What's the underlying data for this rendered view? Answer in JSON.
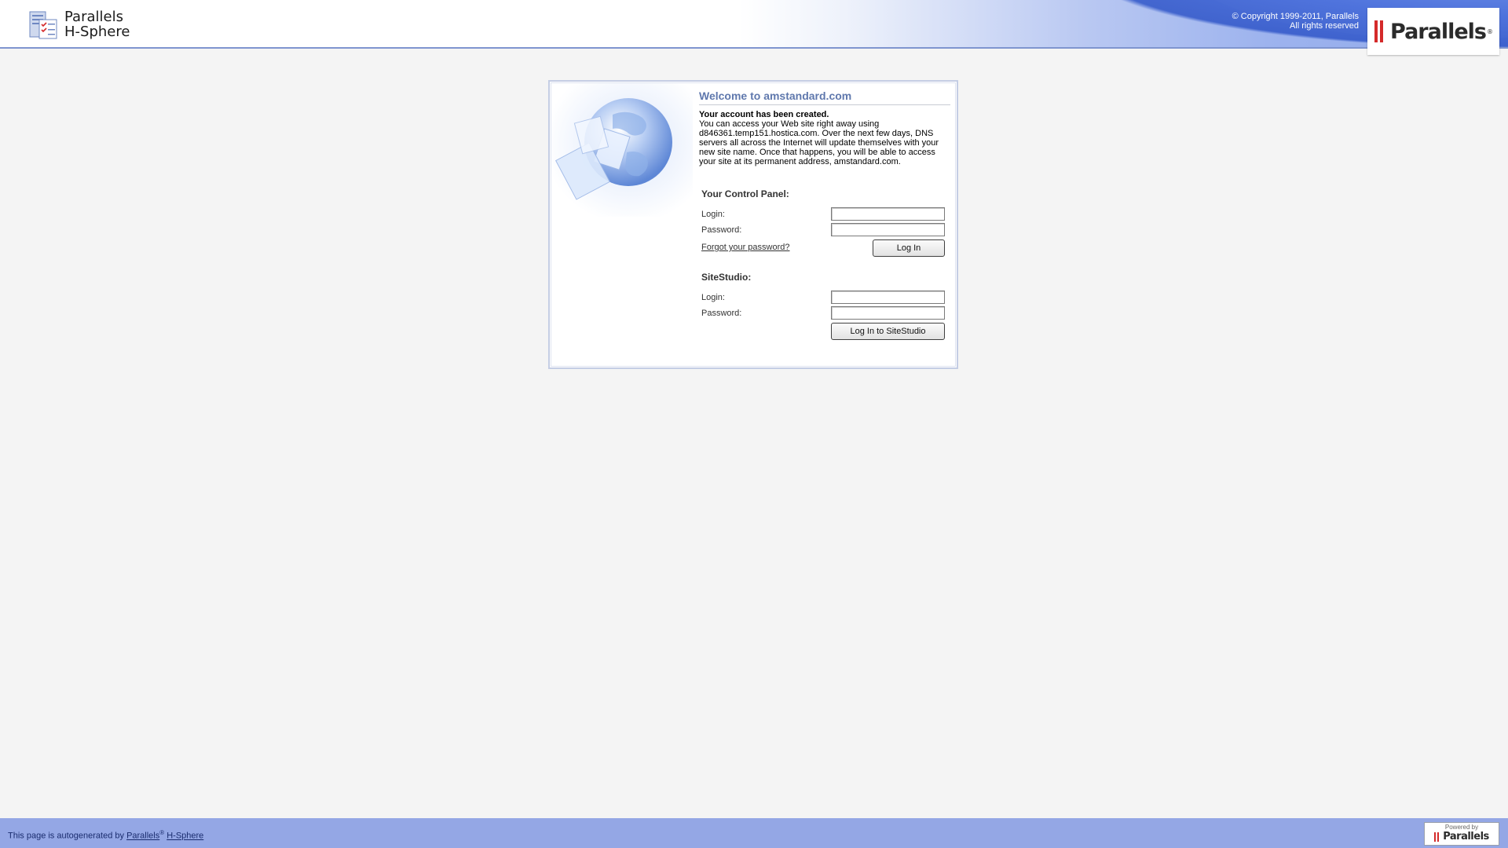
{
  "header": {
    "product_line1": "Parallels",
    "product_line2": "H-Sphere",
    "copyright_line1": "© Copyright 1999-2011, Parallels",
    "copyright_line2": "All rights reserved",
    "brand_name": "Parallels",
    "brand_mark": "®"
  },
  "welcome": {
    "title": "Welcome to amstandard.com",
    "created": "Your account has been created.",
    "message": "You can access your Web site right away using d846361.temp151.hostica.com. Over the next few days, DNS servers all across the Internet will update themselves with your new site name. Once that happens, you will be able to access your site at its permanent address, amstandard.com."
  },
  "control_panel": {
    "title": "Your Control Panel:",
    "login_label": "Login:",
    "login_value": "",
    "password_label": "Password:",
    "password_value": "",
    "forgot_link": "Forgot your password?",
    "login_button": "Log In"
  },
  "sitestudio": {
    "title": "SiteStudio:",
    "login_label": "Login:",
    "login_value": "",
    "password_label": "Password:",
    "password_value": "",
    "login_button": "Log In to SiteStudio"
  },
  "footer": {
    "text": "This page is autogenerated by",
    "link1": "Parallels",
    "link1_mark": "®",
    "link2": "H-Sphere",
    "powered_label": "Powered by",
    "powered_brand": "Parallels"
  },
  "colors": {
    "header_blue": "#3f66d9",
    "title_blue": "#5f78ad",
    "footer_blue": "#94a7e5",
    "brand_red": "#d42a2a"
  },
  "icons": [
    "hsphere-logo-icon",
    "globe-illustration",
    "parallels-bars-icon"
  ]
}
